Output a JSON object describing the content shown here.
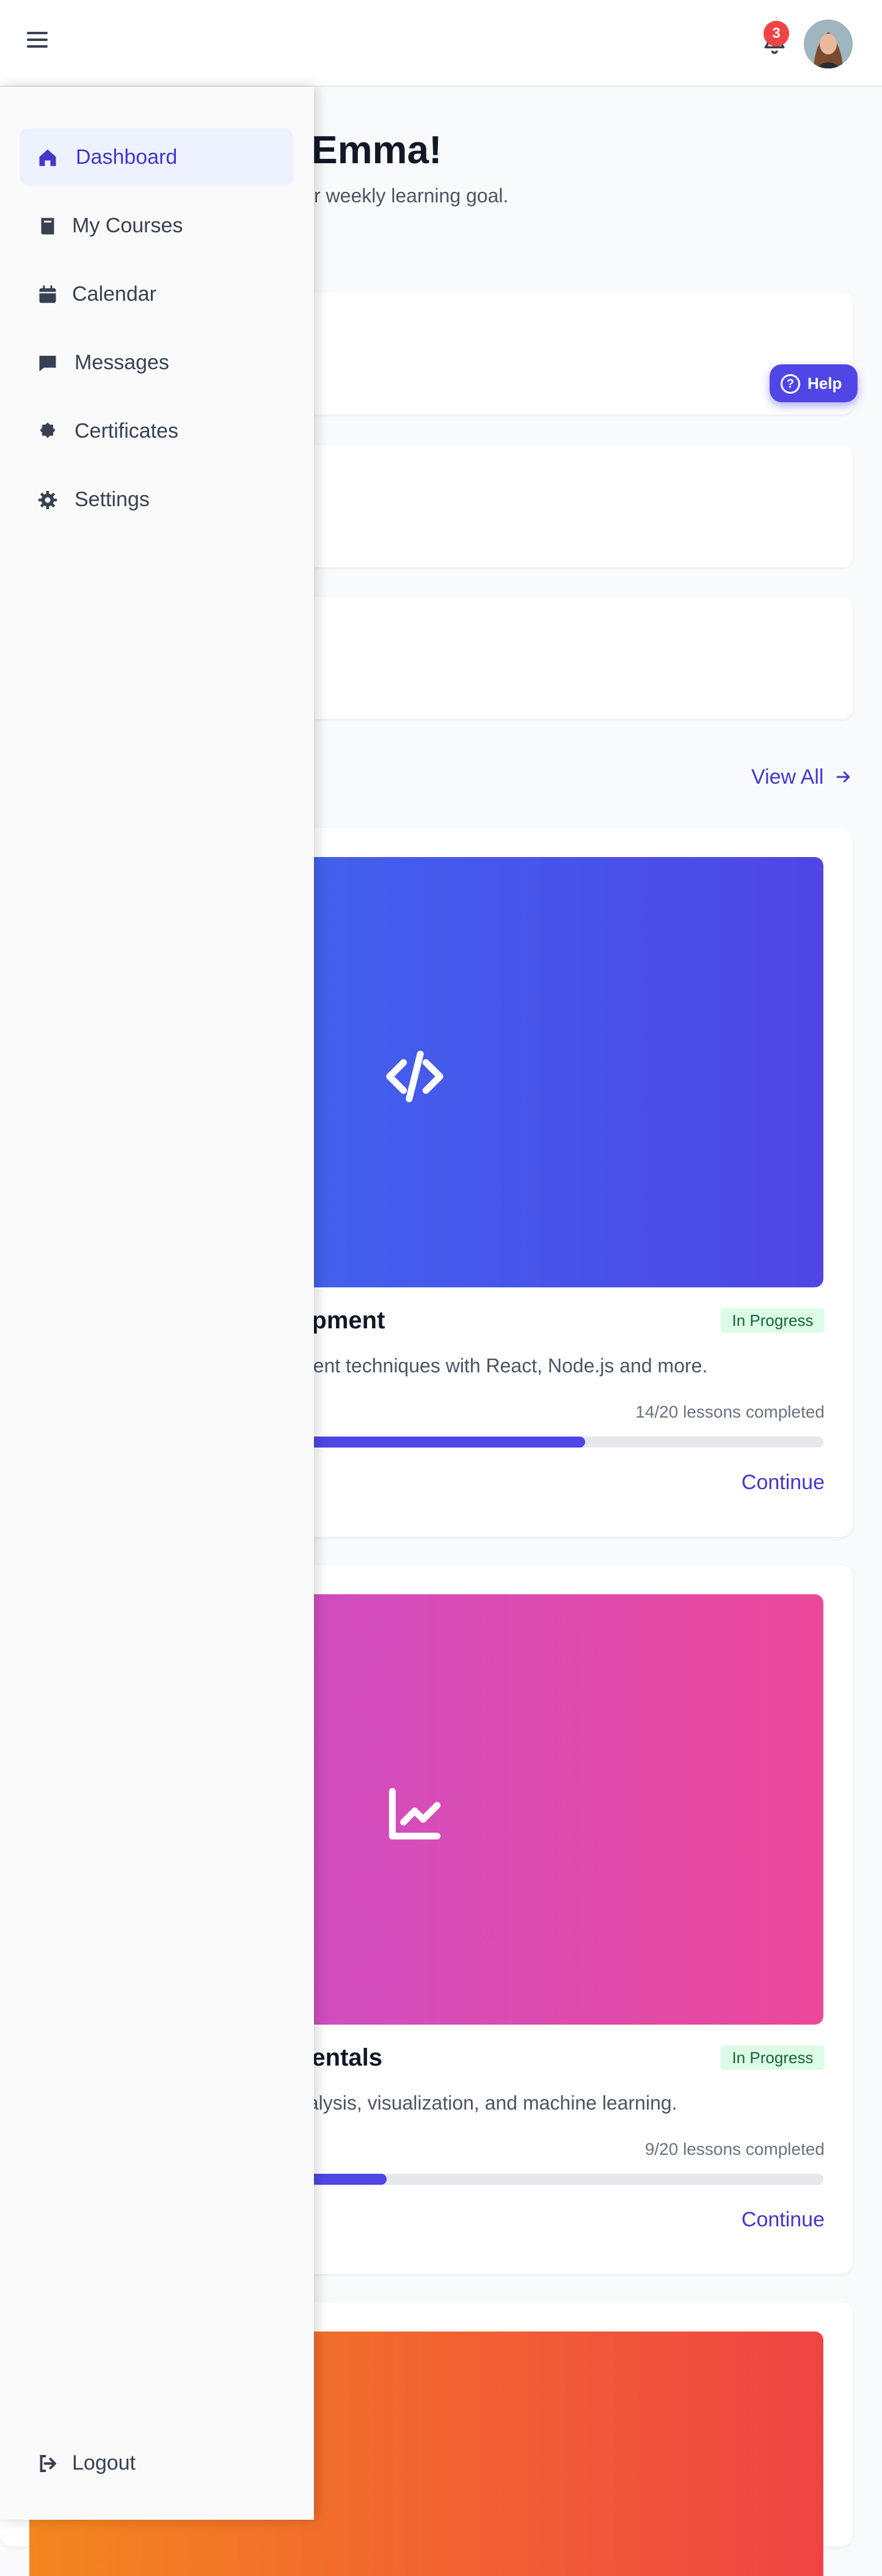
{
  "header": {
    "notification_count": "3"
  },
  "welcome": {
    "title": "Emma!",
    "subtitle": "r weekly learning goal."
  },
  "help": {
    "label": "Help"
  },
  "courses_section": {
    "view_all": "View All"
  },
  "courses": [
    {
      "title": "opment",
      "status": "In Progress",
      "description": "ment techniques with React, Node.js and more.",
      "lessons": "14/20 lessons completed",
      "progress": 0.7,
      "action": "Continue",
      "gradient": [
        "#3b6ff0",
        "#4f46e5"
      ],
      "icon": "code-icon"
    },
    {
      "title": "nentals",
      "status": "In Progress",
      "description": "nalysis, visualization, and machine learning.",
      "lessons": "9/20 lessons completed",
      "progress": 0.45,
      "action": "Continue",
      "gradient": [
        "#c050d6",
        "#ec4899"
      ],
      "icon": "chart-line-icon"
    },
    {
      "gradient": [
        "#f3861e",
        "#ef4444"
      ]
    }
  ],
  "sidebar": {
    "items": [
      {
        "label": "Dashboard",
        "icon": "home-icon",
        "active": true
      },
      {
        "label": "My Courses",
        "icon": "book-icon"
      },
      {
        "label": "Calendar",
        "icon": "calendar-icon"
      },
      {
        "label": "Messages",
        "icon": "message-icon"
      },
      {
        "label": "Certificates",
        "icon": "certificate-icon"
      },
      {
        "label": "Settings",
        "icon": "gear-icon"
      }
    ],
    "logout": "Logout"
  },
  "colors": {
    "accent": "#4f46e5",
    "danger": "#ef4444"
  }
}
